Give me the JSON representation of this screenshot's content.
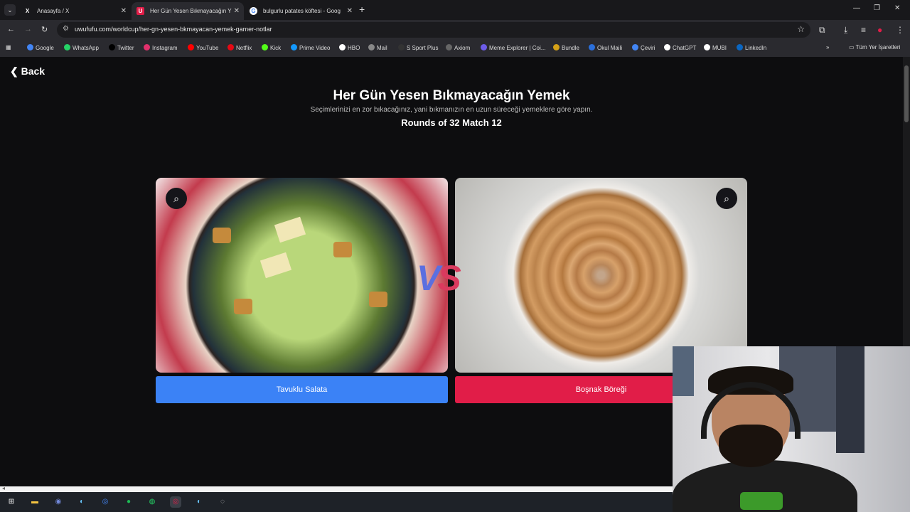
{
  "browser": {
    "tabs": [
      {
        "label": "Anasayfa / X",
        "favicon": "X",
        "active": false
      },
      {
        "label": "Her Gün Yesen Bıkmayacağın Y",
        "favicon": "U",
        "active": true
      },
      {
        "label": "bulgurlu patates köftesi - Goog",
        "favicon": "G",
        "active": false
      }
    ],
    "url": "uwufufu.com/worldcup/her-gn-yesen-bkmayacan-yemek-gamer-notlar",
    "bookmarks": [
      {
        "label": "Google",
        "color": "#4285f4"
      },
      {
        "label": "WhatsApp",
        "color": "#25d366"
      },
      {
        "label": "Twitter",
        "color": "#000000"
      },
      {
        "label": "Instagram",
        "color": "#e1306c"
      },
      {
        "label": "YouTube",
        "color": "#ff0000"
      },
      {
        "label": "Netflix",
        "color": "#e50914"
      },
      {
        "label": "Kick",
        "color": "#53fc18"
      },
      {
        "label": "Prime Video",
        "color": "#1399ff"
      },
      {
        "label": "HBO",
        "color": "#111111"
      },
      {
        "label": "Mail",
        "color": "#555555"
      },
      {
        "label": "S Sport Plus",
        "color": "#222222"
      },
      {
        "label": "Axiom",
        "color": "#444444"
      },
      {
        "label": "Meme Explorer | Coi...",
        "color": "#6d5ce8"
      },
      {
        "label": "Bundle",
        "color": "#d4a017"
      },
      {
        "label": "Okul Maili",
        "color": "#2a6fdb"
      },
      {
        "label": "Çeviri",
        "color": "#4285f4"
      },
      {
        "label": "ChatGPT",
        "color": "#111111"
      },
      {
        "label": "MUBI",
        "color": "#111111"
      },
      {
        "label": "LinkedIn",
        "color": "#0a66c2"
      }
    ],
    "all_bookmarks_label": "Tüm Yer İşaretleri"
  },
  "page": {
    "back_label": "Back",
    "title": "Her Gün Yesen Bıkmayacağın Yemek",
    "subtitle": "Seçimlerinizi en zor bıkacağınız, yani bıkmanızın en uzun süreceği yemeklere göre yapın.",
    "round_label": "Rounds of 32 Match 12",
    "vs_v": "V",
    "vs_s": "S",
    "left_choice": "Tavuklu Salata",
    "right_choice": "Boşnak Böreği"
  },
  "colors": {
    "left_button": "#3b82f6",
    "right_button": "#e11d48",
    "vs_v": "#5b6fe0",
    "vs_s": "#d93a5e"
  }
}
